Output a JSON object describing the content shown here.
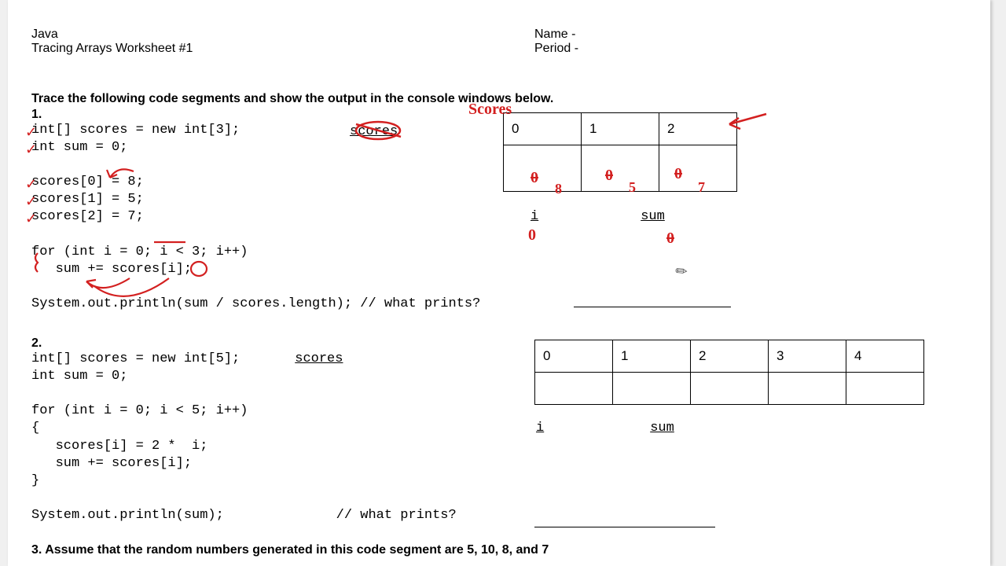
{
  "header": {
    "course": "Java",
    "worksheet": "Tracing Arrays Worksheet #1",
    "name_label": "Name -",
    "period_label": "Period -"
  },
  "instructions": "Trace the following code segments and show the output in the console windows below.",
  "q1": {
    "num": "1.",
    "code_a": "int[] scores = new int[3];\nint sum = 0;\n\nscores[0] = 8;\nscores[1] = 5;\nscores[2] = 7;\n\nfor (int i = 0; i < 3; i++)\n   sum += scores[i];\n\nSystem.out.println(sum / scores.length); // what prints? ",
    "scores_label": "scores",
    "indices": [
      "0",
      "1",
      "2"
    ],
    "i_label": "i",
    "sum_label": "sum"
  },
  "q2": {
    "num": "2.",
    "code_a": "int[] scores = new int[5];",
    "scores_label": "scores",
    "code_b": "int sum = 0;\n\nfor (int i = 0; i < 5; i++)\n{\n   scores[i] = 2 *  i;\n   sum += scores[i];\n}\n\nSystem.out.println(sum);              // what prints? ",
    "indices": [
      "0",
      "1",
      "2",
      "3",
      "4"
    ],
    "i_label": "i",
    "sum_label": "sum"
  },
  "q3_text": "3. Assume that the random numbers generated in this code segment are 5, 10, 8, and 7",
  "handwritten": {
    "scores_top": "Scores",
    "cell0": "0",
    "cell0b": "8",
    "cell1": "0",
    "cell1b": "5",
    "cell2": "0",
    "cell2b": "7",
    "i_val": "0",
    "sum_val": "0"
  }
}
